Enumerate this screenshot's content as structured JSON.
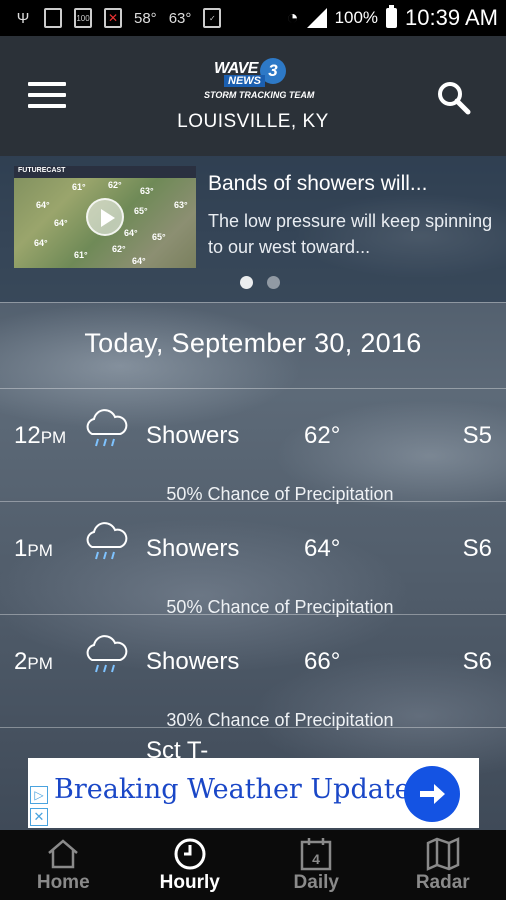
{
  "status_bar": {
    "temp1": "58°",
    "temp2": "63°",
    "battery": "100%",
    "time": "10:39 AM"
  },
  "header": {
    "logo": {
      "brand": "WAVE",
      "channel": "3",
      "news": "NEWS",
      "team": "STORM TRACKING TEAM"
    },
    "location": "LOUISVILLE, KY"
  },
  "news": {
    "title": "Bands of showers will...",
    "body": "The low pressure will keep spinning to our west toward...",
    "thumbnail_header": "FUTURECAST",
    "thumbnail_temps": [
      "61°",
      "62°",
      "63°",
      "64°",
      "64°",
      "65°",
      "65°",
      "64°",
      "61°",
      "62°",
      "63°",
      "64°",
      "64°"
    ],
    "page_count": 2,
    "active_page": 1
  },
  "date": "Today, September 30, 2016",
  "hourly": [
    {
      "hour": "12",
      "ampm": "PM",
      "condition": "Showers",
      "icon": "rain-cloud-icon",
      "temp": "62°",
      "wind": "S5",
      "precip": "50% Chance of Precipitation"
    },
    {
      "hour": "1",
      "ampm": "PM",
      "condition": "Showers",
      "icon": "rain-cloud-icon",
      "temp": "64°",
      "wind": "S6",
      "precip": "50% Chance of Precipitation"
    },
    {
      "hour": "2",
      "ampm": "PM",
      "condition": "Showers",
      "icon": "rain-cloud-icon",
      "temp": "66°",
      "wind": "S6",
      "precip": "30% Chance of Precipitation"
    },
    {
      "condition": "Sct T-"
    }
  ],
  "ad": {
    "text": "Breaking Weather Update"
  },
  "nav": [
    {
      "label": "Home",
      "icon": "home-icon"
    },
    {
      "label": "Hourly",
      "icon": "clock-icon",
      "active": true
    },
    {
      "label": "Daily",
      "icon": "calendar-icon",
      "day": "4"
    },
    {
      "label": "Radar",
      "icon": "map-icon"
    }
  ],
  "colors": {
    "header_bg": "#2b3138",
    "ad_text": "#1a47c7",
    "ad_button": "#1453e3",
    "nav_bg": "#0b0b0b",
    "nav_inactive": "#8a8a8a",
    "nav_active": "#ffffff"
  }
}
